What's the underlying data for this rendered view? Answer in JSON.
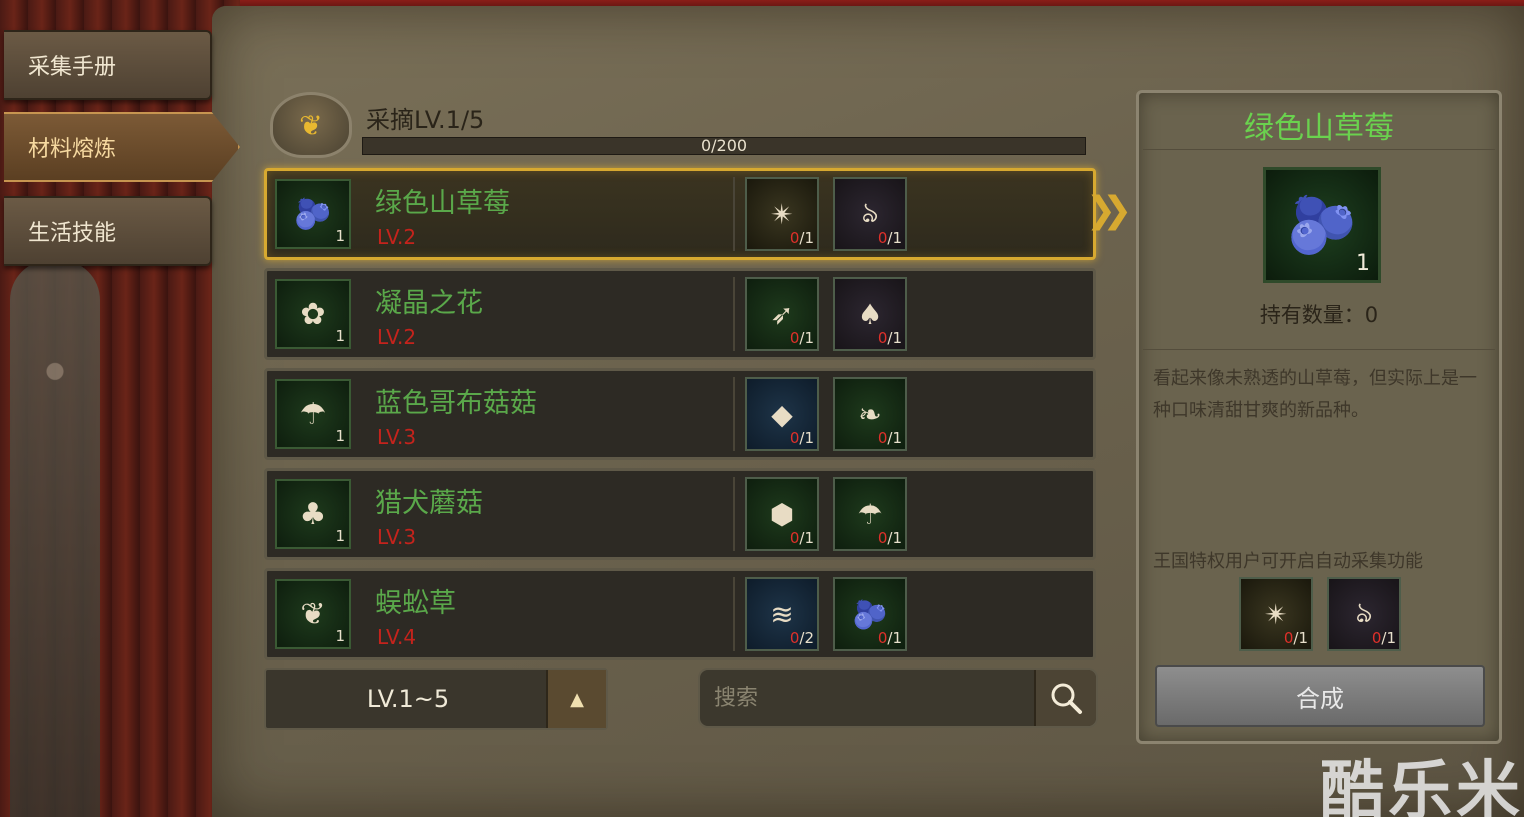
{
  "tabs": [
    {
      "label": "采集手册"
    },
    {
      "label": "材料熔炼"
    },
    {
      "label": "生活技能"
    }
  ],
  "level": {
    "title": "采摘LV.1/5",
    "xp": "0/200"
  },
  "recipes": [
    {
      "name": "绿色山草莓",
      "level": "LV.2",
      "qty": "1",
      "icon": "blackberry-icon",
      "materials": [
        {
          "icon": "yellow-burst-icon",
          "have": "0",
          "need": "/1"
        },
        {
          "icon": "purple-vine-icon",
          "have": "0",
          "need": "/1"
        }
      ]
    },
    {
      "name": "凝晶之花",
      "level": "LV.2",
      "qty": "1",
      "icon": "crystal-flower-icon",
      "materials": [
        {
          "icon": "fishing-lure-icon",
          "have": "0",
          "need": "/1"
        },
        {
          "icon": "brown-mushroom-icon",
          "have": "0",
          "need": "/1"
        }
      ]
    },
    {
      "name": "蓝色哥布菇菇",
      "level": "LV.3",
      "qty": "1",
      "icon": "blue-mushroom-icon",
      "materials": [
        {
          "icon": "ore-nugget-icon",
          "have": "0",
          "need": "/1"
        },
        {
          "icon": "seed-pod-icon",
          "have": "0",
          "need": "/1"
        }
      ]
    },
    {
      "name": "猎犬蘑菇",
      "level": "LV.3",
      "qty": "1",
      "icon": "chanterelle-icon",
      "materials": [
        {
          "icon": "blue-crystal-icon",
          "have": "0",
          "need": "/1"
        },
        {
          "icon": "blue-mushroom-icon",
          "have": "0",
          "need": "/1"
        }
      ]
    },
    {
      "name": "蜈蚣草",
      "level": "LV.4",
      "qty": "1",
      "icon": "herb-leaf-icon",
      "materials": [
        {
          "icon": "fish-icon",
          "have": "0",
          "need": "/2"
        },
        {
          "icon": "blackberry-icon",
          "have": "0",
          "need": "/1"
        }
      ]
    }
  ],
  "filter": {
    "level_range": "LV.1~5",
    "search_placeholder": "搜索"
  },
  "detail": {
    "title": "绿色山草莓",
    "qty": "1",
    "owned": "持有数量：0",
    "description": "看起来像未熟透的山草莓，但实际上是一种口味清甜甘爽的新品种。",
    "auto_note": "王国特权用户可开启自动采集功能",
    "materials": [
      {
        "icon": "yellow-burst-icon",
        "have": "0",
        "need": "/1"
      },
      {
        "icon": "purple-vine-icon",
        "have": "0",
        "need": "/1"
      }
    ],
    "craft_label": "合成"
  },
  "watermark": "酷乐米",
  "colors": {
    "item_name": "#5aa84a",
    "level_red": "#c4231c",
    "selected_border": "#d7a930",
    "detail_title": "#6ad24e"
  }
}
